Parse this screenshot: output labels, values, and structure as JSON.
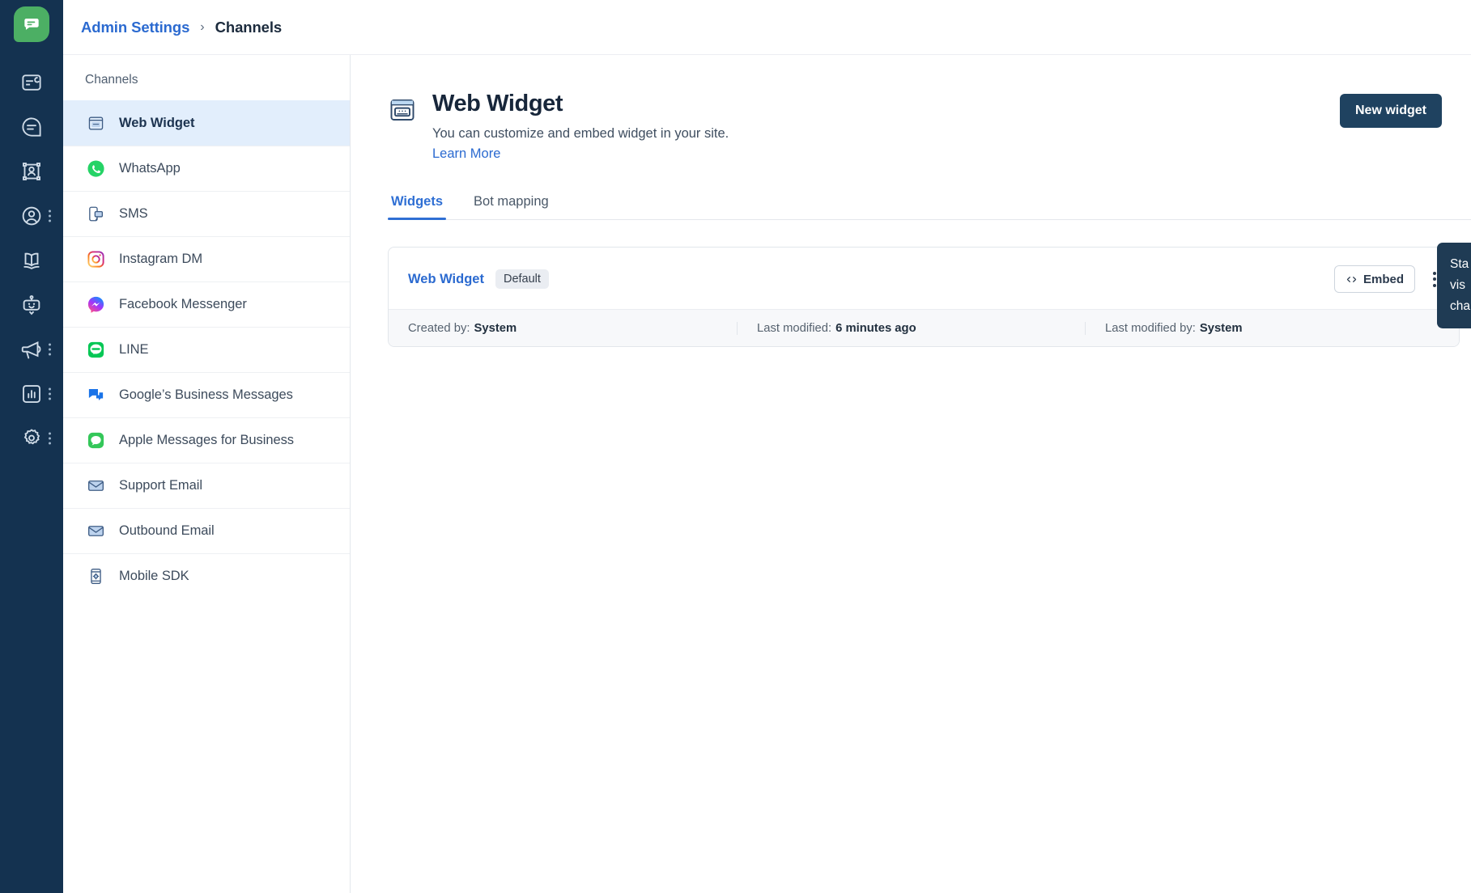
{
  "rail": {
    "logo_icon": "chat-bubble-logo",
    "items": [
      {
        "icon": "inbox-card-icon",
        "name": "inbox",
        "has_menu": false
      },
      {
        "icon": "conversation-icon",
        "name": "conversations",
        "has_menu": false
      },
      {
        "icon": "contact-frame-icon",
        "name": "contacts",
        "has_menu": false
      },
      {
        "icon": "user-circle-icon",
        "name": "people",
        "has_menu": true
      },
      {
        "icon": "book-icon",
        "name": "knowledge",
        "has_menu": false
      },
      {
        "icon": "bot-icon",
        "name": "bots",
        "has_menu": false
      },
      {
        "icon": "megaphone-icon",
        "name": "campaigns",
        "has_menu": true
      },
      {
        "icon": "bar-chart-icon",
        "name": "reports",
        "has_menu": true
      },
      {
        "icon": "gear-icon",
        "name": "settings",
        "has_menu": true
      }
    ]
  },
  "breadcrumb": {
    "root": "Admin Settings",
    "separator": "›",
    "current": "Channels"
  },
  "channels_panel": {
    "title": "Channels",
    "items": [
      {
        "label": "Web Widget",
        "icon": "web-widget-icon",
        "active": true,
        "has_menu": false
      },
      {
        "label": "WhatsApp",
        "icon": "whatsapp-icon",
        "active": false,
        "has_menu": false
      },
      {
        "label": "SMS",
        "icon": "sms-icon",
        "active": false,
        "has_menu": true
      },
      {
        "label": "Instagram DM",
        "icon": "instagram-icon",
        "active": false,
        "has_menu": false
      },
      {
        "label": "Facebook Messenger",
        "icon": "messenger-icon",
        "active": false,
        "has_menu": false
      },
      {
        "label": "LINE",
        "icon": "line-icon",
        "active": false,
        "has_menu": true
      },
      {
        "label": "Google’s Business Messages",
        "icon": "google-business-icon",
        "active": false,
        "has_menu": true
      },
      {
        "label": "Apple Messages for Business",
        "icon": "apple-messages-icon",
        "active": false,
        "has_menu": true
      },
      {
        "label": "Support Email",
        "icon": "envelope-icon",
        "active": false,
        "has_menu": false
      },
      {
        "label": "Outbound Email",
        "icon": "envelope-icon",
        "active": false,
        "has_menu": false
      },
      {
        "label": "Mobile SDK",
        "icon": "mobile-sdk-icon",
        "active": false,
        "has_menu": false
      }
    ]
  },
  "main": {
    "icon": "web-widget-header-icon",
    "title": "Web Widget",
    "subtitle": "You can customize and embed widget in your site.",
    "learn_more": "Learn More",
    "new_widget_button": "New widget",
    "tabs": [
      {
        "label": "Widgets",
        "selected": true
      },
      {
        "label": "Bot mapping",
        "selected": false
      }
    ],
    "widget_card": {
      "name": "Web Widget",
      "badge": "Default",
      "embed_button": "Embed",
      "embed_icon": "code-brackets-icon",
      "kebab_icon": "more-vertical-icon",
      "meta": [
        {
          "label": "Created by:",
          "value": "System"
        },
        {
          "label": "Last modified:",
          "value": "6 minutes ago"
        },
        {
          "label": "Last modified by:",
          "value": "System"
        }
      ]
    }
  },
  "tooltip": {
    "line1": "Sta",
    "line2": "vis",
    "line3": "cha"
  },
  "colors": {
    "rail_bg": "#143250",
    "accent_blue": "#2b6ad0",
    "tab_blue": "#2f6fd4",
    "button_navy": "#1f4260",
    "active_item_bg": "#e2eefc",
    "logo_green": "#4caf64",
    "tooltip_bg": "#1f3b54"
  }
}
